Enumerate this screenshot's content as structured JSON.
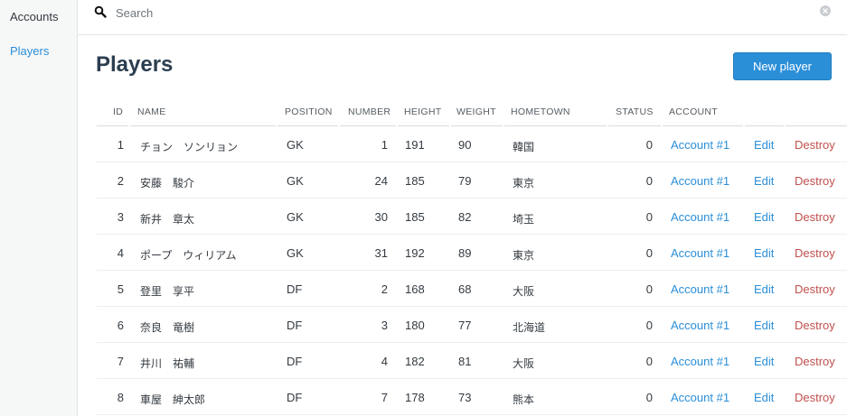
{
  "sidebar": {
    "items": [
      {
        "label": "Accounts",
        "active": false
      },
      {
        "label": "Players",
        "active": true
      }
    ]
  },
  "search": {
    "placeholder": "Search",
    "value": ""
  },
  "header": {
    "title": "Players",
    "new_button": "New player"
  },
  "table": {
    "columns": [
      "ID",
      "NAME",
      "POSITION",
      "NUMBER",
      "HEIGHT",
      "WEIGHT",
      "HOMETOWN",
      "STATUS",
      "ACCOUNT"
    ],
    "rows": [
      {
        "id": "1",
        "name": "チョン　ソンリョン",
        "position": "GK",
        "number": "1",
        "height": "191",
        "weight": "90",
        "hometown": "韓国",
        "status": "0",
        "account": "Account #1",
        "edit": "Edit",
        "destroy": "Destroy"
      },
      {
        "id": "2",
        "name": "安藤　駿介",
        "position": "GK",
        "number": "24",
        "height": "185",
        "weight": "79",
        "hometown": "東京",
        "status": "0",
        "account": "Account #1",
        "edit": "Edit",
        "destroy": "Destroy"
      },
      {
        "id": "3",
        "name": "新井　章太",
        "position": "GK",
        "number": "30",
        "height": "185",
        "weight": "82",
        "hometown": "埼玉",
        "status": "0",
        "account": "Account #1",
        "edit": "Edit",
        "destroy": "Destroy"
      },
      {
        "id": "4",
        "name": "ポープ　ウィリアム",
        "position": "GK",
        "number": "31",
        "height": "192",
        "weight": "89",
        "hometown": "東京",
        "status": "0",
        "account": "Account #1",
        "edit": "Edit",
        "destroy": "Destroy"
      },
      {
        "id": "5",
        "name": "登里　享平",
        "position": "DF",
        "number": "2",
        "height": "168",
        "weight": "68",
        "hometown": "大阪",
        "status": "0",
        "account": "Account #1",
        "edit": "Edit",
        "destroy": "Destroy"
      },
      {
        "id": "6",
        "name": "奈良　竜樹",
        "position": "DF",
        "number": "3",
        "height": "180",
        "weight": "77",
        "hometown": "北海道",
        "status": "0",
        "account": "Account #1",
        "edit": "Edit",
        "destroy": "Destroy"
      },
      {
        "id": "7",
        "name": "井川　祐輔",
        "position": "DF",
        "number": "4",
        "height": "182",
        "weight": "81",
        "hometown": "大阪",
        "status": "0",
        "account": "Account #1",
        "edit": "Edit",
        "destroy": "Destroy"
      },
      {
        "id": "8",
        "name": "車屋　紳太郎",
        "position": "DF",
        "number": "7",
        "height": "178",
        "weight": "73",
        "hometown": "熊本",
        "status": "0",
        "account": "Account #1",
        "edit": "Edit",
        "destroy": "Destroy"
      }
    ]
  },
  "colors": {
    "accent": "#2b8fd8",
    "danger": "#c0504d",
    "title": "#2c3e50"
  }
}
